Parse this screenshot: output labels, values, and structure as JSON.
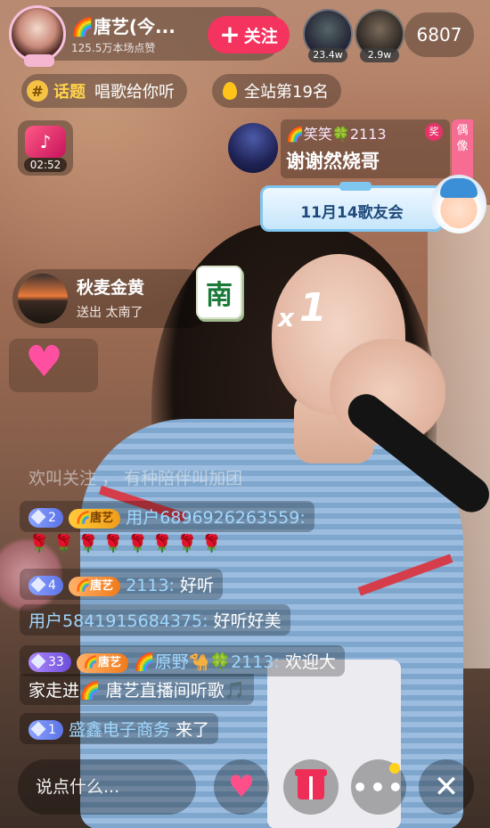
{
  "header": {
    "anchor_name": "🌈唐艺(今...",
    "anchor_likes": "125.5万本场点赞",
    "follow_label": "关注",
    "viewers": [
      {
        "badge": "23.4w"
      },
      {
        "badge": "2.9w"
      }
    ],
    "online_count": "6807"
  },
  "tags": {
    "topic_label": "话题",
    "topic_text": "唱歌给你听",
    "rank_text": "全站第19名"
  },
  "music": {
    "time": "02:52"
  },
  "thanks": {
    "name": "🌈笑笑🍀2113",
    "award": "奖",
    "text": "谢谢然烧哥"
  },
  "idol_tab": "偶像",
  "event_banner": "11月14歌友会",
  "gift": {
    "sender": "秋麦金黄",
    "action": "送出 太南了",
    "tile_char": "南",
    "combo_x": "x",
    "combo_num": "1"
  },
  "chat": {
    "faded_row": "欢叫关注 ， 有种陪伴叫加团",
    "rows": [
      {
        "level": "2",
        "fan": "🌈唐艺",
        "user": "用户6896926263559:",
        "text": ""
      },
      {
        "roses": "🌹🌹🌹🌹🌹🌹🌹🌹"
      },
      {
        "level": "4",
        "fan": "🌈唐艺",
        "user": "2113:",
        "text": "好听"
      },
      {
        "user": "用户5841915684375:",
        "text": "好听好美"
      },
      {
        "level": "33",
        "fan": "🌈唐艺",
        "user": "🌈原野🐪🍀2113:",
        "text": "欢迎大"
      },
      {
        "text": "家走进🌈 唐艺直播间听歌🎵"
      },
      {
        "level": "1",
        "user": "盛鑫电子商务",
        "text": "来了"
      }
    ]
  },
  "bottom": {
    "input_placeholder": "说点什么...",
    "more": "•••",
    "close": "✕"
  }
}
